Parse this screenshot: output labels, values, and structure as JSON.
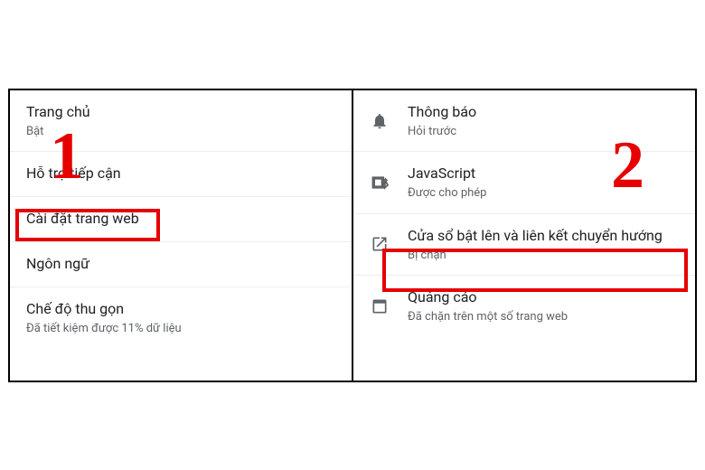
{
  "annotations": {
    "step1": "1",
    "step2": "2"
  },
  "left": {
    "items": [
      {
        "title": "Trang chủ",
        "sub": "Bật"
      },
      {
        "title": "Hỗ trợ tiếp cận",
        "sub": ""
      },
      {
        "title": "Cài đặt trang web",
        "sub": ""
      },
      {
        "title": "Ngôn ngữ",
        "sub": ""
      },
      {
        "title": "Chế độ thu gọn",
        "sub": "Đã tiết kiệm được 11% dữ liệu"
      }
    ]
  },
  "right": {
    "items": [
      {
        "icon": "bell-icon",
        "title": "Thông báo",
        "sub": "Hỏi trước"
      },
      {
        "icon": "js-icon",
        "title": "JavaScript",
        "sub": "Được cho phép"
      },
      {
        "icon": "popup-icon",
        "title": "Cửa sổ bật lên và liên kết chuyển hướng",
        "sub": "Bị chặn"
      },
      {
        "icon": "ads-icon",
        "title": "Quảng cáo",
        "sub": "Đã chặn trên một số trang web"
      }
    ]
  }
}
